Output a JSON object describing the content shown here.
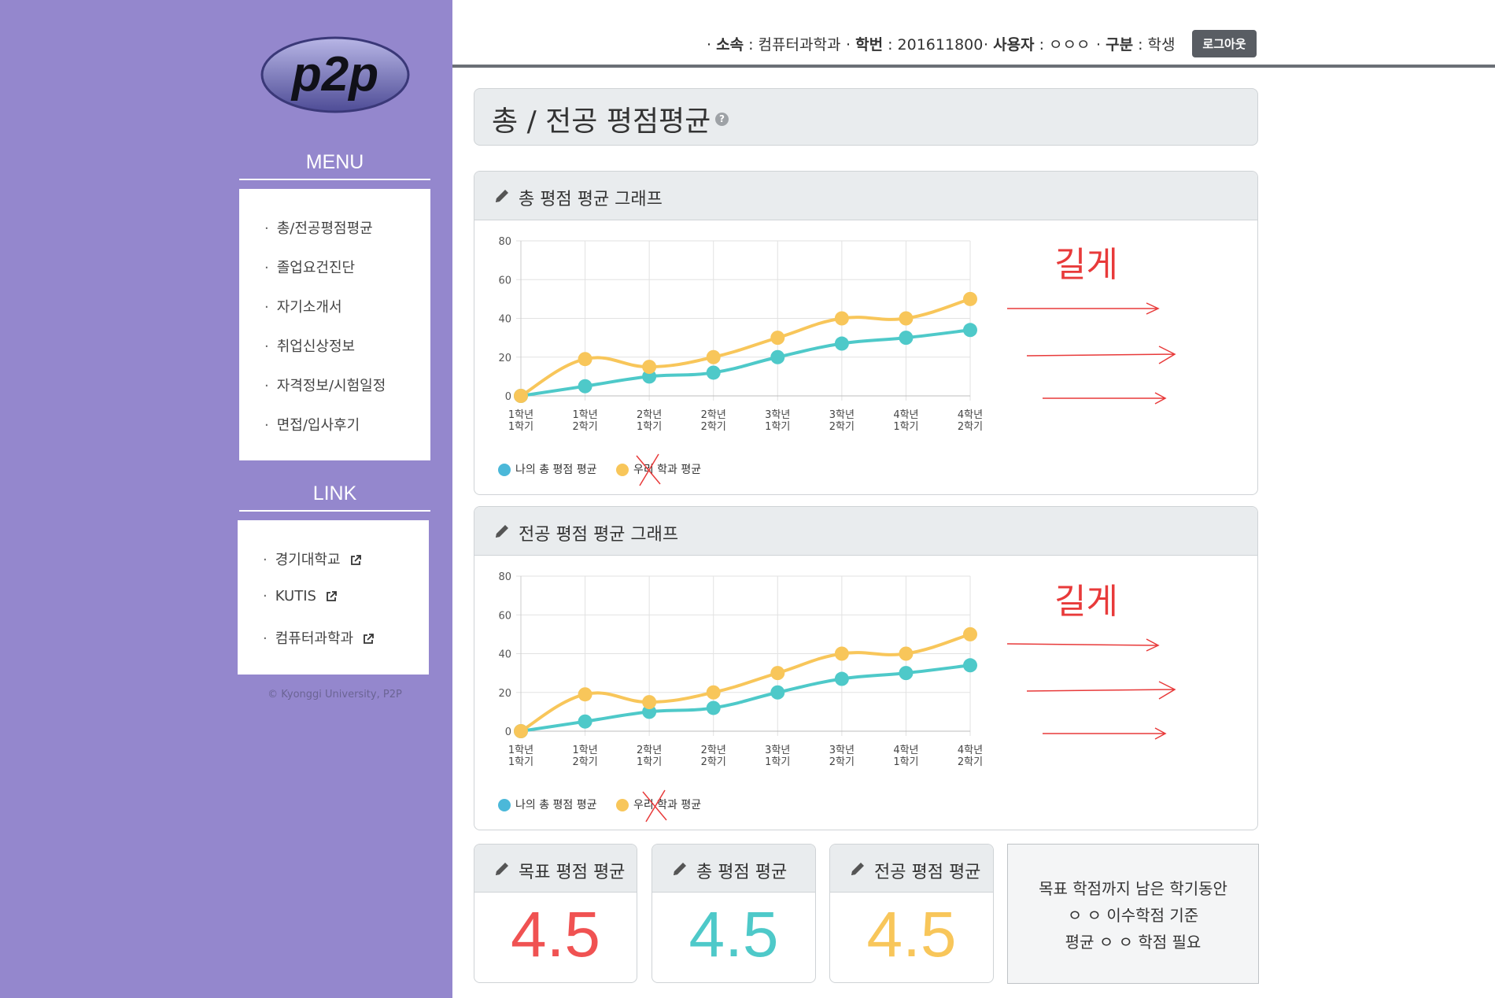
{
  "logo": {
    "text": "p2p"
  },
  "sidebar": {
    "menu_title": "MENU",
    "menu_items": [
      {
        "label": "총/전공평점평균"
      },
      {
        "label": "졸업요건진단"
      },
      {
        "label": "자기소개서"
      },
      {
        "label": "취업신상정보"
      },
      {
        "label": "자격정보/시험일정"
      },
      {
        "label": "면접/입사후기"
      }
    ],
    "link_title": "LINK",
    "link_items": [
      {
        "label": "경기대학교"
      },
      {
        "label": "KUTIS"
      },
      {
        "label": "컴퓨터과학과"
      }
    ],
    "bullet": "·",
    "copyright": "© Kyonggi University, P2P"
  },
  "header": {
    "dept_label": "소속",
    "dept_value": "컴퓨터과학과",
    "id_label": "학번",
    "id_value": "201611800",
    "user_label": "사용자",
    "user_value": "ㅇㅇㅇ",
    "role_label": "구분",
    "role_value": "학생",
    "logout_label": "로그아웃"
  },
  "page": {
    "title": "총 / 전공 평점평균",
    "help": "?"
  },
  "charts": [
    {
      "title": "총 평점 평균 그래프",
      "annotation": "길게"
    },
    {
      "title": "전공 평점 평균 그래프",
      "annotation": "길게"
    }
  ],
  "chart_data": [
    {
      "type": "line",
      "title": "총 평점 평균 그래프",
      "categories": [
        [
          "1학년",
          "1학기"
        ],
        [
          "1학년",
          "2학기"
        ],
        [
          "2학년",
          "1학기"
        ],
        [
          "2학년",
          "2학기"
        ],
        [
          "3학년",
          "1학기"
        ],
        [
          "3학년",
          "2학기"
        ],
        [
          "4학년",
          "1학기"
        ],
        [
          "4학년",
          "2학기"
        ]
      ],
      "series": [
        {
          "name": "나의 총 평점 평균",
          "color": "#4ec9c9",
          "legend_color": "#4bb8d9",
          "values": [
            0,
            5,
            10,
            12,
            20,
            27,
            30,
            34
          ]
        },
        {
          "name": "우리 학과 평균",
          "color": "#f8c65a",
          "legend_color": "#f8c65a",
          "values": [
            0,
            19,
            15,
            20,
            30,
            40,
            40,
            50
          ]
        }
      ],
      "ylim": [
        0,
        80
      ],
      "yticks": [
        0,
        20,
        40,
        60,
        80
      ],
      "grid": true,
      "legend_position": "bottom-left"
    },
    {
      "type": "line",
      "title": "전공 평점 평균 그래프",
      "categories": [
        [
          "1학년",
          "1학기"
        ],
        [
          "1학년",
          "2학기"
        ],
        [
          "2학년",
          "1학기"
        ],
        [
          "2학년",
          "2학기"
        ],
        [
          "3학년",
          "1학기"
        ],
        [
          "3학년",
          "2학기"
        ],
        [
          "4학년",
          "1학기"
        ],
        [
          "4학년",
          "2학기"
        ]
      ],
      "series": [
        {
          "name": "나의 총 평점 평균",
          "color": "#4ec9c9",
          "legend_color": "#4bb8d9",
          "values": [
            0,
            5,
            10,
            12,
            20,
            27,
            30,
            34
          ]
        },
        {
          "name": "우리 학과 평균",
          "color": "#f8c65a",
          "legend_color": "#f8c65a",
          "values": [
            0,
            19,
            15,
            20,
            30,
            40,
            40,
            50
          ]
        }
      ],
      "ylim": [
        0,
        80
      ],
      "yticks": [
        0,
        20,
        40,
        60,
        80
      ],
      "grid": true,
      "legend_position": "bottom-left"
    }
  ],
  "stats": [
    {
      "title": "목표 평점 평균",
      "value": "4.5",
      "color": "#f05252"
    },
    {
      "title": "총 평점 평균",
      "value": "4.5",
      "color": "#4ec9c9"
    },
    {
      "title": "전공 평점 평균",
      "value": "4.5",
      "color": "#f8c65a"
    }
  ],
  "note": {
    "line1": "목표 학점까지 남은 학기동안",
    "line2": "ㅇ ㅇ 이수학점 기준",
    "line3": "평균 ㅇ ㅇ 학점 필요"
  },
  "colors": {
    "sidebar": "#9487cd",
    "panel_head": "#e9ecee",
    "annotation": "#e83a3a"
  }
}
